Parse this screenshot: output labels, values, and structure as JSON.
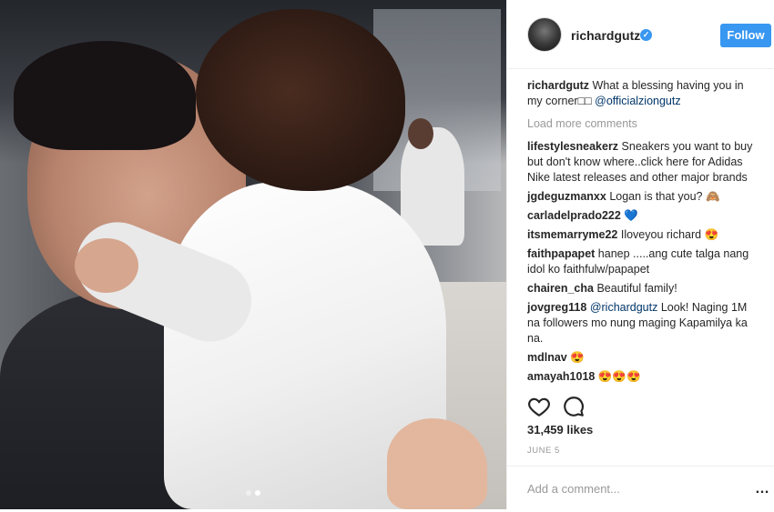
{
  "post": {
    "username": "richardgutz",
    "verified": true,
    "follow_label": "Follow",
    "caption_text": "What a blessing having you in my corner□□",
    "caption_mention": "@officialziongutz",
    "load_more": "Load more comments",
    "comments": [
      {
        "user": "lifestylesneakerz",
        "text": "Sneakers you want to buy but don't know where..click here for Adidas Nike latest releases and other major brands"
      },
      {
        "user": "jgdeguzmanxx",
        "text": "Logan is that you? 🙈"
      },
      {
        "user": "carladelprado222",
        "text": "💙"
      },
      {
        "user": "itsmemarryme22",
        "text": "Iloveyou richard 😍"
      },
      {
        "user": "faithpapapet",
        "text": "hanep .....ang cute talga nang idol ko faithfulw/papapet"
      },
      {
        "user": "chairen_cha",
        "text": "Beautiful family!"
      },
      {
        "user": "jovgreg118",
        "mention": "@richardgutz",
        "text": "Look! Naging 1M na followers mo nung maging Kapamilya ka na."
      },
      {
        "user": "mdlnav",
        "text": "😍"
      },
      {
        "user": "amayah1018",
        "text": "😍😍😍"
      }
    ],
    "likes": "31,459 likes",
    "date": "JUNE 5",
    "add_comment_placeholder": "Add a comment...",
    "more_label": "…",
    "carousel": {
      "count": 2,
      "active_index": 1
    }
  },
  "icons": {
    "like": "heart-icon",
    "comment": "comment-bubble-icon",
    "verified": "verified-badge-icon",
    "more": "more-options-icon"
  },
  "colors": {
    "accent": "#3897f0",
    "text": "#262626",
    "muted": "#999999",
    "mention": "#003569",
    "border": "#efefef"
  }
}
